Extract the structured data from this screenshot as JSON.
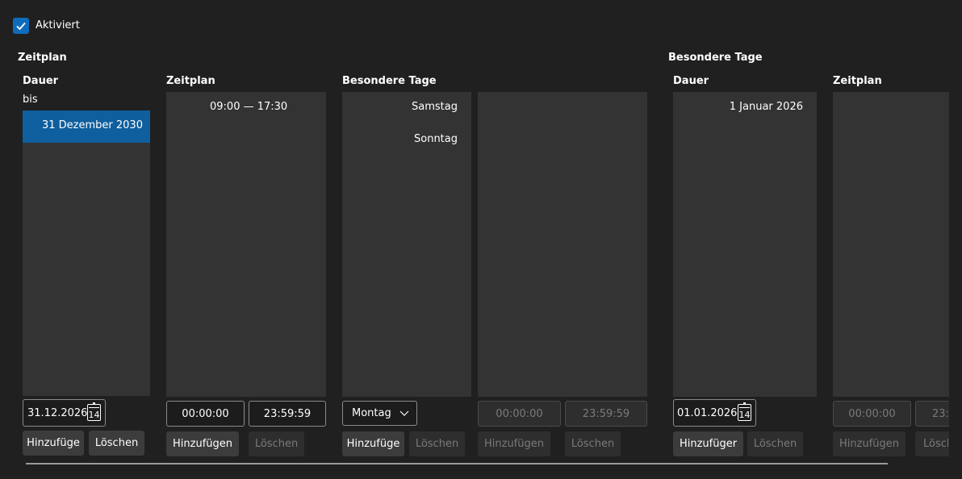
{
  "enabled": {
    "label": "Aktiviert",
    "checked": true
  },
  "sections": {
    "left_title": "Zeitplan",
    "right_title": "Besondere Tage"
  },
  "columns": {
    "dauer1": {
      "title": "Dauer",
      "sub": "bis",
      "items": [
        "31 Dezember 2030"
      ],
      "date_value": "31.12.2026",
      "cal_day": "14",
      "add": "Hinzufüge",
      "delete": "Löschen"
    },
    "zeitplan1": {
      "title": "Zeitplan",
      "items": [
        "09:00 — 17:30"
      ],
      "from": "00:00:00",
      "to": "23:59:59",
      "add": "Hinzufügen",
      "delete": "Löschen"
    },
    "besondere1": {
      "title": "Besondere Tage",
      "items": [
        "Samstag",
        "Sonntag"
      ],
      "select_value": "Montag",
      "add": "Hinzufüge",
      "delete": "Löschen"
    },
    "times1": {
      "from": "00:00:00",
      "to": "23:59:59",
      "add": "Hinzufügen",
      "delete": "Löschen"
    },
    "dauer2": {
      "title": "Dauer",
      "items": [
        "1 Januar 2026"
      ],
      "date_value": "01.01.2026",
      "cal_day": "14",
      "add": "Hinzufüger",
      "delete": "Löschen"
    },
    "zeitplan2": {
      "title": "Zeitplan",
      "from": "00:00:00",
      "to": "23:",
      "add": "Hinzufügen",
      "delete": "Lösch"
    }
  },
  "colors": {
    "accent": "#0f6cbd",
    "selection": "#0f5f9e",
    "background": "#202020",
    "list": "#333333"
  }
}
